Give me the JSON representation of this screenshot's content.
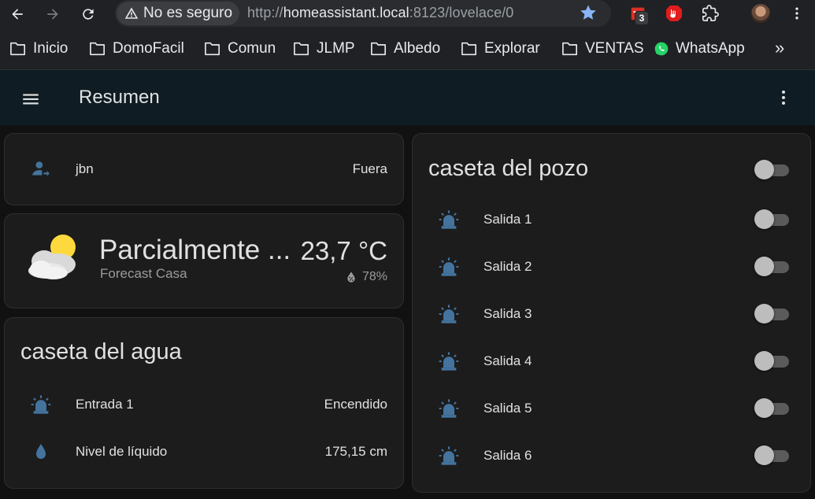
{
  "browser": {
    "security_label": "No es seguro",
    "url_scheme": "http://",
    "url_host": "homeassistant.local",
    "url_path": ":8123/lovelace/0",
    "extension_badge": "3"
  },
  "bookmarks": [
    {
      "label": "Inicio",
      "icon": "folder-icon"
    },
    {
      "label": "DomoFacil",
      "icon": "folder-icon"
    },
    {
      "label": "Comun",
      "icon": "folder-icon"
    },
    {
      "label": "JLMP",
      "icon": "folder-icon"
    },
    {
      "label": "Albedo",
      "icon": "folder-icon"
    },
    {
      "label": "Explorar",
      "icon": "folder-icon"
    },
    {
      "label": "VENTAS",
      "icon": "folder-icon"
    },
    {
      "label": "WhatsApp",
      "icon": "whatsapp-icon"
    }
  ],
  "bookmarks_more": "»",
  "header": {
    "title": "Resumen"
  },
  "person": {
    "name": "jbn",
    "state": "Fuera",
    "icon": "account-arrow-right-icon"
  },
  "weather": {
    "condition": "Parcialmente ...",
    "source": "Forecast Casa",
    "temperature": "23,7 °C",
    "humidity": "78%",
    "icon": "partly-cloudy-icon"
  },
  "caseta_agua": {
    "title": "caseta del agua",
    "rows": [
      {
        "name": "Entrada 1",
        "state": "Encendido",
        "icon": "alarm-light-icon"
      },
      {
        "name": "Nivel de líquido",
        "state": "175,15 cm",
        "icon": "water-drop-icon"
      }
    ]
  },
  "caseta_pozo": {
    "title": "caseta del pozo",
    "master_toggle": false,
    "rows": [
      {
        "name": "Salida 1",
        "on": false,
        "icon": "alarm-light-icon"
      },
      {
        "name": "Salida 2",
        "on": false,
        "icon": "alarm-light-icon"
      },
      {
        "name": "Salida 3",
        "on": false,
        "icon": "alarm-light-icon"
      },
      {
        "name": "Salida 4",
        "on": false,
        "icon": "alarm-light-icon"
      },
      {
        "name": "Salida 5",
        "on": false,
        "icon": "alarm-light-icon"
      },
      {
        "name": "Salida 6",
        "on": false,
        "icon": "alarm-light-icon"
      }
    ]
  },
  "colors": {
    "icon_blue": "#44739e",
    "card_bg": "#1c1c1c",
    "header_bg": "#0f1c23",
    "chrome_bg": "#202124"
  }
}
